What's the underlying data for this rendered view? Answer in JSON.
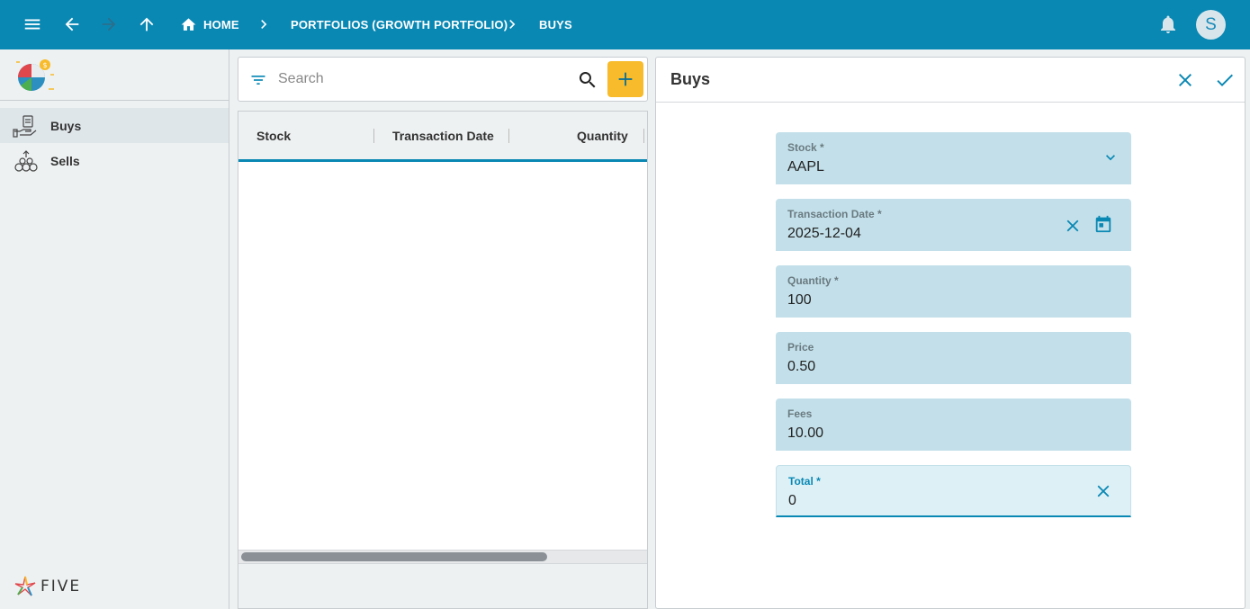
{
  "topbar": {
    "breadcrumbs": [
      "HOME",
      "PORTFOLIOS (GROWTH PORTFOLIO)",
      "BUYS"
    ],
    "avatar_initial": "S"
  },
  "sidebar": {
    "items": [
      {
        "label": "Buys",
        "active": true
      },
      {
        "label": "Sells",
        "active": false
      }
    ],
    "footer_logo_text": "FIVE"
  },
  "list": {
    "search_placeholder": "Search",
    "columns": [
      "Stock",
      "Transaction Date",
      "Quantity"
    ],
    "rows": []
  },
  "form": {
    "title": "Buys",
    "fields": [
      {
        "label": "Stock *",
        "value": "AAPL"
      },
      {
        "label": "Transaction Date *",
        "value": "2025-12-04"
      },
      {
        "label": "Quantity *",
        "value": "100"
      },
      {
        "label": "Price",
        "value": "0.50"
      },
      {
        "label": "Fees",
        "value": "10.00"
      },
      {
        "label": "Total *",
        "value": "0"
      }
    ]
  },
  "colors": {
    "topbar": "#0a88b4",
    "accent_add": "#f7bb2b",
    "field_bg": "#c3e0ea"
  }
}
